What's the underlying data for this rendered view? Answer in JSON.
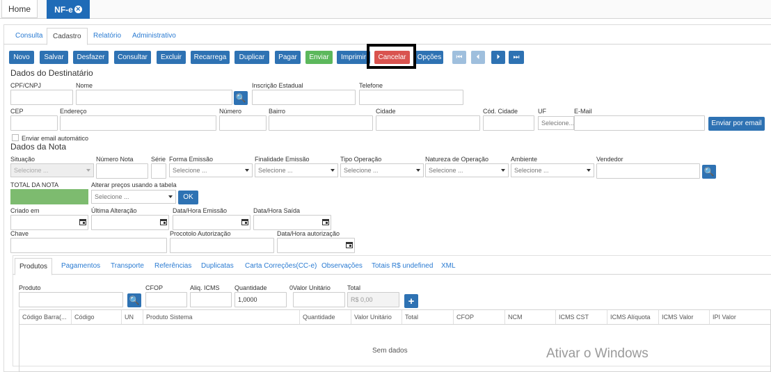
{
  "topbar": {
    "home": "Home",
    "nfe": "NF-e"
  },
  "tabs": [
    "Consulta",
    "Cadastro",
    "Relatório",
    "Administrativo"
  ],
  "toolbar": [
    "Novo",
    "Salvar",
    "Desfazer",
    "Consultar",
    "Excluir",
    "Recarrega",
    "Duplicar",
    "Pagar",
    "Enviar",
    "Imprimir",
    "Cancelar",
    "Opções"
  ],
  "destinatario": {
    "title": "Dados do Destinatário",
    "cpf": "CPF/CNPJ",
    "nome": "Nome",
    "ie": "Inscrição Estadual",
    "telefone": "Telefone",
    "cep": "CEP",
    "endereco": "Endereço",
    "numero": "Número",
    "bairro": "Bairro",
    "cidade": "Cidade",
    "cod_cidade": "Cód. Cidade",
    "uf": "UF",
    "uf_value": "Selecione...",
    "email": "E-Mail",
    "enviar_email": "Enviar por email",
    "auto_email": "Enviar email automático"
  },
  "nota": {
    "title": "Dados da Nota",
    "situacao": "Situação",
    "numero_nota": "Número Nota",
    "serie": "Série",
    "forma_emissao": "Forma Emissão",
    "finalidade": "Finalidade Emissão",
    "tipo_operacao": "Tipo Operação",
    "natureza": "Natureza de Operação",
    "ambiente": "Ambiente",
    "vendedor": "Vendedor",
    "select_placeholder": "Selecione ...",
    "total_nota": "TOTAL DA NOTA",
    "alterar_precos": "Alterar preços usando a tabela",
    "ok": "OK",
    "criado_em": "Criado em",
    "ultima_alteracao": "Última Alteração",
    "dh_emissao": "Data/Hora Emissão",
    "dh_saida": "Data/Hora Saída",
    "chave": "Chave",
    "protocolo": "Procotolo Autorização",
    "dh_autorizacao": "Data/Hora autorização"
  },
  "inner_tabs": [
    "Produtos",
    "Pagamentos",
    "Transporte",
    "Referências",
    "Duplicatas",
    "Carta Correções(CC-e)",
    "Observações",
    "Totais R$ undefined",
    "XML"
  ],
  "produtos": {
    "produto": "Produto",
    "cfop": "CFOP",
    "aliq_icms": "Aliq. ICMS",
    "quantidade": "Quantidade",
    "quantidade_value": "1,0000",
    "valor_unitario": "0Valor Unitário",
    "total": "Total",
    "total_value": "R$ 0,00"
  },
  "grid": {
    "headers": [
      "Código Barra(...",
      "Código",
      "UN",
      "Produto Sistema",
      "Quantidade",
      "Valor Unitário",
      "Total",
      "CFOP",
      "NCM",
      "ICMS CST",
      "ICMS Alíquota",
      "ICMS Valor",
      "IPI Valor"
    ],
    "empty": "Sem dados"
  },
  "watermark": "Ativar o Windows"
}
